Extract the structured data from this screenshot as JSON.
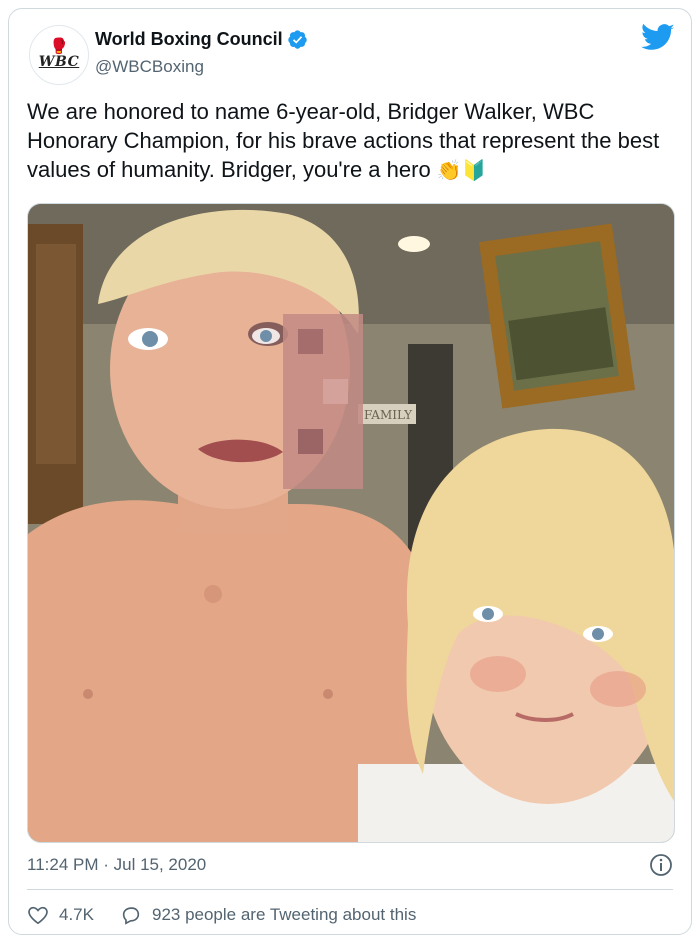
{
  "account": {
    "display_name": "World Boxing Council",
    "handle": "@WBCBoxing",
    "avatar_text": "WBC",
    "verified": true
  },
  "tweet": {
    "text": "We are honored to name 6-year-old, Bridger Walker, WBC Honorary Champion, for his brave actions that represent the best values of humanity. Bridger, you're a hero",
    "emojis": "👏🔰",
    "photo_sign": "FAMILY",
    "timestamp": "11:24 PM · Jul 15, 2020"
  },
  "engagement": {
    "likes": "4.7K",
    "conversation": "923 people are Tweeting about this"
  },
  "colors": {
    "twitter_blue": "#1d9bf0",
    "muted_text": "#536471",
    "border": "#cfd9de"
  },
  "icons": [
    "wbc-logo-icon",
    "verified-badge-icon",
    "twitter-bird-icon",
    "info-icon",
    "heart-icon",
    "comment-bubble-icon"
  ]
}
